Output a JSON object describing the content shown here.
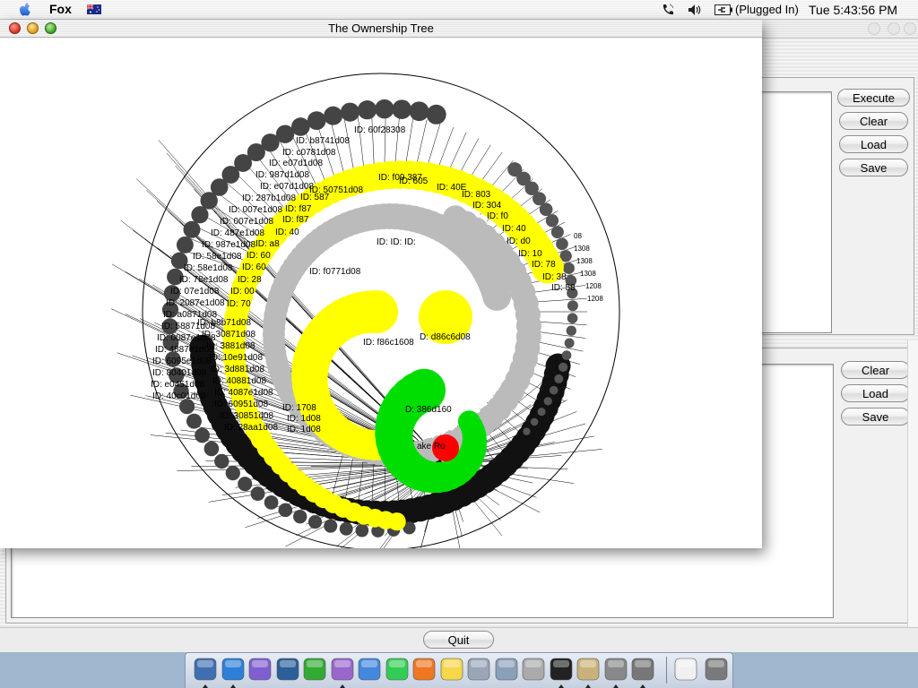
{
  "menubar": {
    "app_name": "Fox",
    "battery_status": "(Plugged In)",
    "clock": "Tue 5:43:56 PM",
    "icons": [
      "apple-icon",
      "australian-flag-icon",
      "phone-icon",
      "speaker-icon",
      "battery-icon"
    ]
  },
  "tree_window": {
    "title": "The Ownership Tree",
    "colors": {
      "root": "#ff0000",
      "level1": "#00dd00",
      "level2": "#ffff00",
      "level3": "#bbbbbb",
      "level4": "#444444",
      "edges": "#000000"
    },
    "root_label": "ake Ro",
    "labels_green": [
      "D: 386d160"
    ],
    "labels_yellow_inner": [
      "ID: f86c1608",
      "D: d86c6d08"
    ],
    "labels_grey": [
      "ID: f0771d08",
      "ID: ID: ID:"
    ],
    "labels_yellow_outer": [
      "ID: 50751d08",
      "ID: f09 387",
      "ID: 605",
      "ID: 40E",
      "ID: 803",
      "ID: 304",
      "ID: f0",
      "ID: 40",
      "ID: d0",
      "ID: 10",
      "ID: 78",
      "ID: 38",
      "ID: 58",
      "ID: 587",
      "ID: f87",
      "ID: f87",
      "ID: 40",
      "ID: a8",
      "ID: 60",
      "ID: 60",
      "ID: 28",
      "ID: 00",
      "ID: 70"
    ],
    "labels_dark": [
      "ID: 60f28308",
      "ID: b8741d08",
      "ID: c0781d08",
      "ID: e07d1d08",
      "ID: 987d1d08",
      "ID: e07d1d08",
      "ID: 287b1d08",
      "ID: 007e1d08",
      "ID: 007e1d08",
      "ID: 487e1d08",
      "ID: 987e1d08",
      "ID: 58e1d08",
      "ID: 58e1d08",
      "ID: 78e1d08",
      "ID: 07e1d08",
      "ID: 2087e1d08",
      "ID: a0871d08",
      "ID: 58871d08",
      "ID: 0087e1d08",
      "ID: 4887e1d08",
      "ID: 6095e1d08",
      "ID: 80401d08",
      "ID: e0451d08",
      "ID: 40c01d08"
    ],
    "labels_left_cluster": [
      "ID: b8b71d08",
      "ID: 30871d08",
      "ID: 3881d08",
      "ID: 10e91d08",
      "ID: 3d881d08",
      "ID: 40881d08",
      "ID: 4087e1d08",
      "ID: 60951d08",
      "ID: 30851d08",
      "ID: 28aa1d08",
      "ID: 1708",
      "ID: 1d08",
      "ID: 1d08"
    ],
    "labels_right_fragments": [
      "08",
      "1308",
      "1308",
      "1308",
      "1208",
      "1208"
    ]
  },
  "right_panel": {
    "top_buttons": [
      "Execute",
      "Clear",
      "Load",
      "Save"
    ],
    "bottom_buttons": [
      "Clear",
      "Load",
      "Save"
    ]
  },
  "quit_button": "Quit",
  "dock": {
    "apps": [
      {
        "name": "finder-icon",
        "running": true
      },
      {
        "name": "internet-explorer-icon",
        "running": true
      },
      {
        "name": "mail-icon",
        "running": false
      },
      {
        "name": "netscape-icon",
        "running": false
      },
      {
        "name": "icq-flower-icon",
        "running": false
      },
      {
        "name": "itunes-icon",
        "running": true
      },
      {
        "name": "msn-messenger-icon",
        "running": false
      },
      {
        "name": "msn-butterfly-icon",
        "running": false
      },
      {
        "name": "pages-icon",
        "running": false
      },
      {
        "name": "stickies-icon",
        "running": false
      },
      {
        "name": "textedit-icon",
        "running": false
      },
      {
        "name": "system-preferences-icon",
        "running": false
      },
      {
        "name": "x11-icon",
        "running": false
      },
      {
        "name": "terminal-icon",
        "running": true
      },
      {
        "name": "script-editor-icon",
        "running": true
      },
      {
        "name": "utility-icon",
        "running": true
      },
      {
        "name": "tools-icon",
        "running": true
      },
      {
        "name": "documents-folder-icon",
        "running": false
      },
      {
        "name": "trash-icon",
        "running": false
      }
    ]
  }
}
